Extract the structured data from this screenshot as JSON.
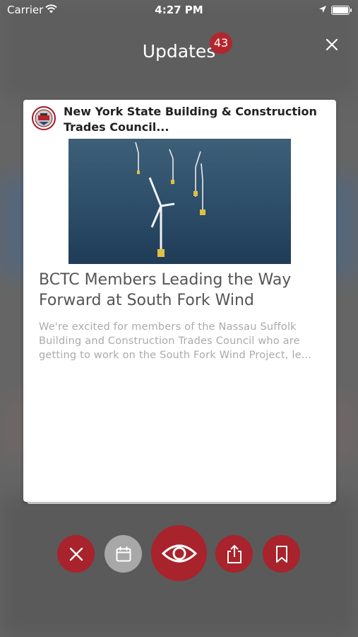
{
  "status_bar": {
    "carrier": "Carrier",
    "time": "4:27 PM"
  },
  "header": {
    "title": "Updates",
    "badge_count": "43"
  },
  "card": {
    "source_name": "New York State Building & Construction Trades Council...",
    "headline": "BCTC Members Leading the Way Forward at South Fork Wind",
    "excerpt": "We're excited for members of the Nassau Suffolk Building and Construction Trades Council who are getting to work on the South Fork Wind Project, le..."
  },
  "actions": [
    {
      "name": "dismiss",
      "icon": "close-icon",
      "enabled": true
    },
    {
      "name": "calendar",
      "icon": "calendar-icon",
      "enabled": false
    },
    {
      "name": "view",
      "icon": "eye-icon",
      "enabled": true
    },
    {
      "name": "share",
      "icon": "share-icon",
      "enabled": true
    },
    {
      "name": "bookmark",
      "icon": "bookmark-icon",
      "enabled": true
    }
  ],
  "colors": {
    "accent": "#a8232b",
    "disabled": "#a8a8a8",
    "badge": "#b3262e"
  }
}
